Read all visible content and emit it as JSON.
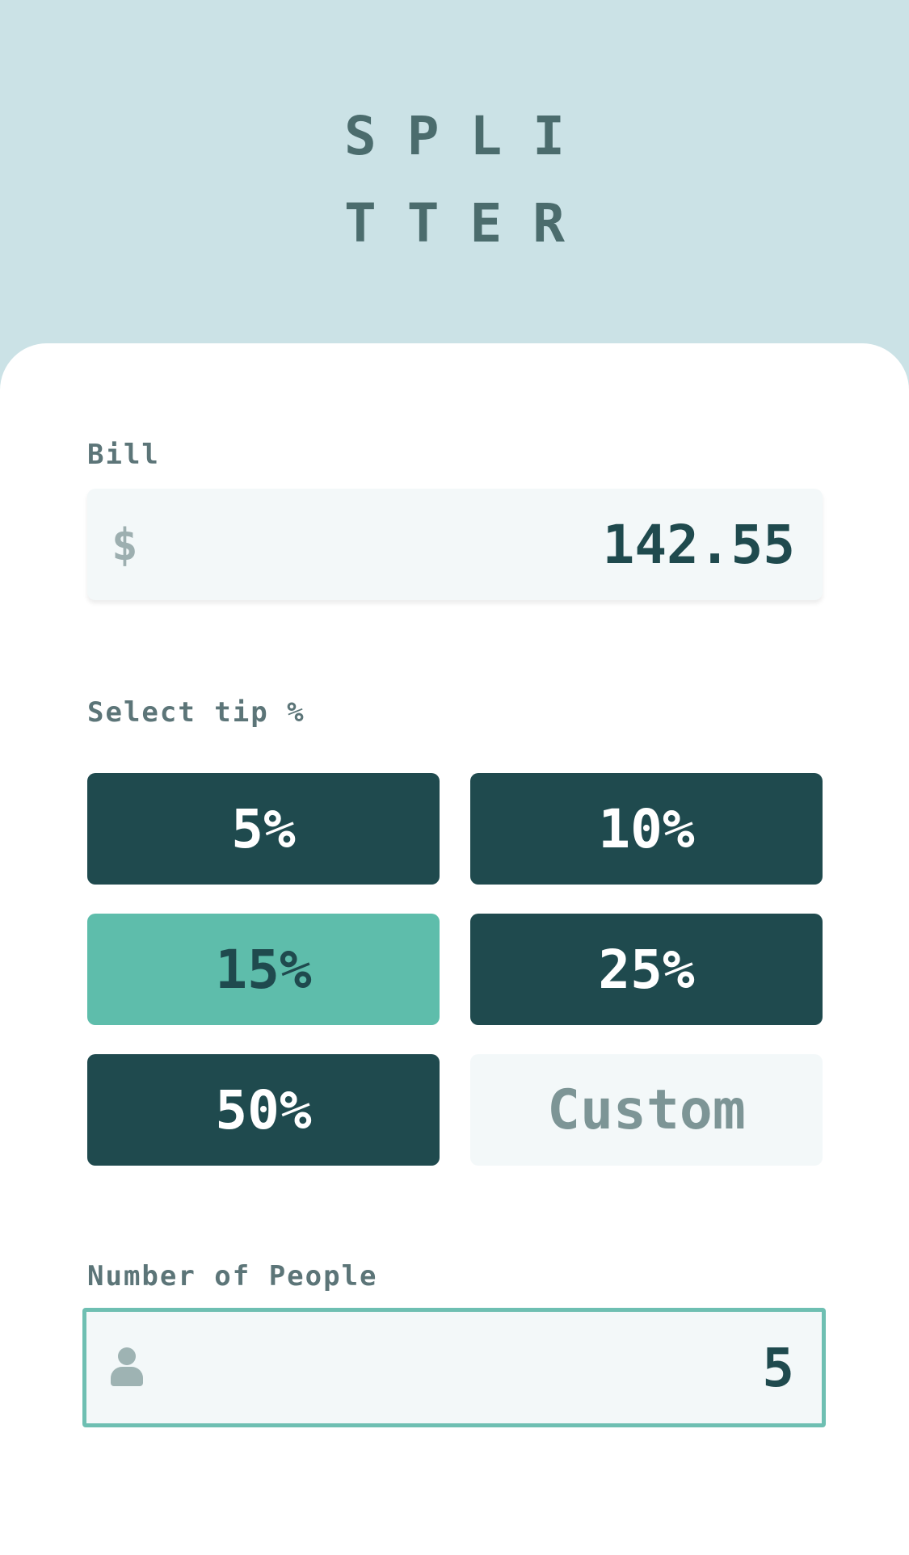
{
  "header": {
    "logo_line_1": "SPLI",
    "logo_line_2": "TTER"
  },
  "bill": {
    "label": "Bill",
    "currency_symbol": "$",
    "value": "142.55"
  },
  "tip": {
    "label": "Select tip %",
    "options": [
      {
        "label": "5%",
        "selected": false
      },
      {
        "label": "10%",
        "selected": false
      },
      {
        "label": "15%",
        "selected": true
      },
      {
        "label": "25%",
        "selected": false
      },
      {
        "label": "50%",
        "selected": false
      }
    ],
    "custom_label": "Custom"
  },
  "people": {
    "label": "Number of People",
    "icon": "person-icon",
    "value": "5"
  },
  "colors": {
    "background": "#cbe2e6",
    "primary_dark": "#1f4a4e",
    "accent": "#5ebdab",
    "input_bg": "#f3f8f9",
    "label": "#5c7578",
    "focus_border": "#6ebfb2"
  }
}
